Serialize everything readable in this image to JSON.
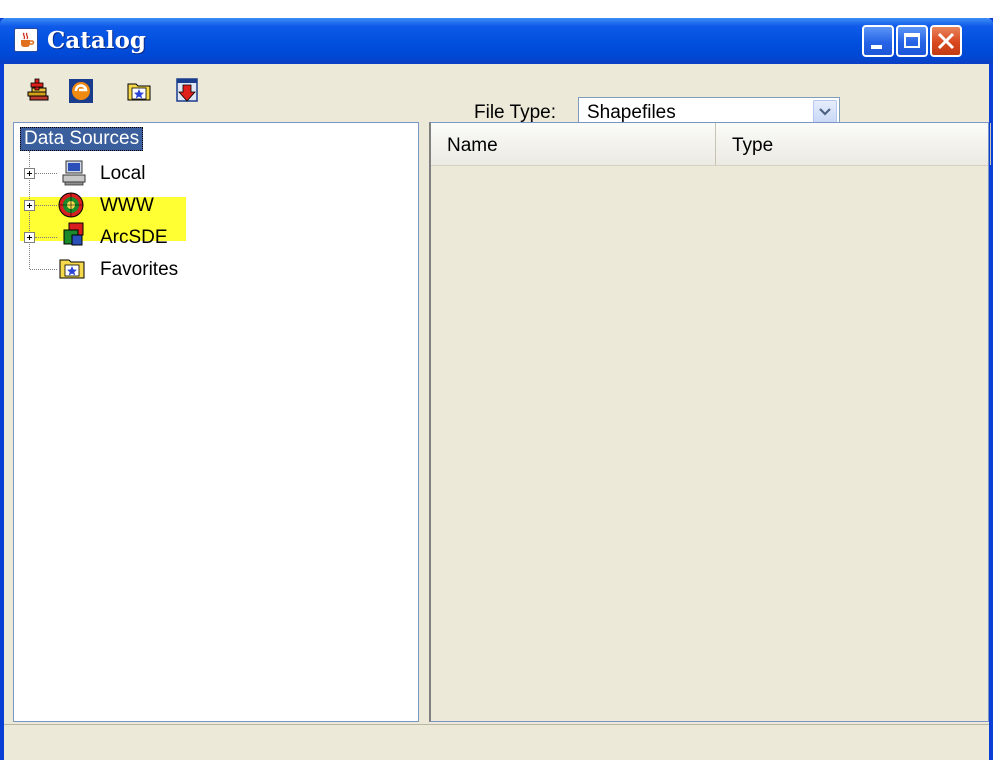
{
  "window": {
    "title": "Catalog"
  },
  "toolbar": {
    "tools": [
      {
        "name": "add-data-icon"
      },
      {
        "name": "arcims-globe-icon"
      },
      {
        "name": "favorites-folder-icon"
      },
      {
        "name": "download-icon"
      }
    ],
    "file_type_label": "File Type:",
    "file_type_value": "Shapefiles"
  },
  "tree": {
    "root_label": "Data Sources",
    "items": [
      {
        "label": "Local",
        "icon": "computer-icon",
        "expandable": true
      },
      {
        "label": "WWW",
        "icon": "www-globe-icon",
        "expandable": true,
        "highlighted": true
      },
      {
        "label": "ArcSDE",
        "icon": "arcsde-server-icon",
        "expandable": true
      },
      {
        "label": "Favorites",
        "icon": "favorites-folder-icon",
        "expandable": false
      }
    ]
  },
  "list": {
    "columns": [
      "Name",
      "Type"
    ]
  },
  "status": {
    "text": ""
  },
  "colors": {
    "title_bar": "#0250df",
    "highlight": "#ffff33",
    "selection": "#3a5f9c",
    "window_bg": "#ece9d8"
  }
}
